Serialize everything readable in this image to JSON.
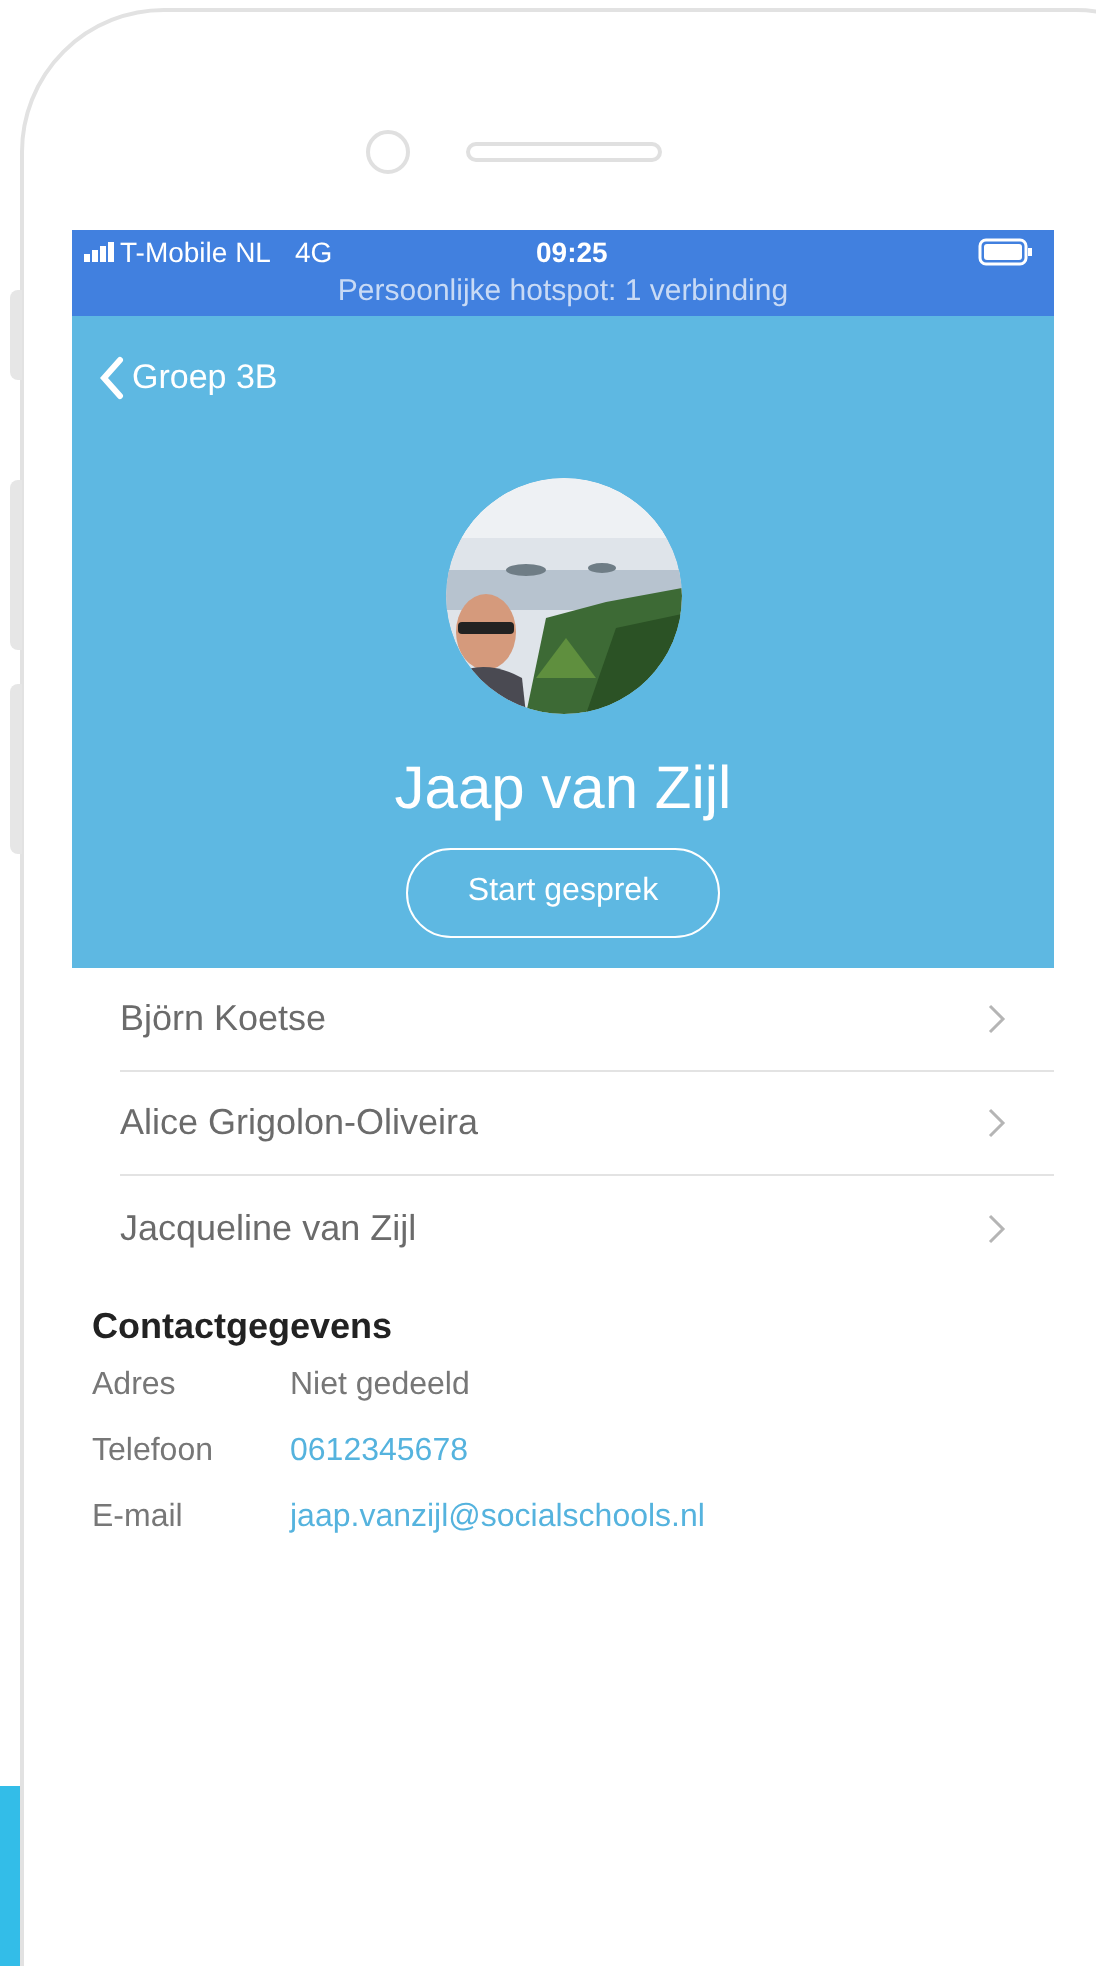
{
  "status_bar": {
    "carrier": "T-Mobile NL",
    "network": "4G",
    "time": "09:25",
    "hotspot": "Persoonlijke hotspot: 1 verbinding"
  },
  "nav": {
    "back_label": "Groep 3B"
  },
  "profile": {
    "name": "Jaap van Zijl",
    "button": "Start gesprek"
  },
  "related": [
    {
      "name": "Björn Koetse"
    },
    {
      "name": "Alice Grigolon-Oliveira"
    },
    {
      "name": "Jacqueline van Zijl"
    }
  ],
  "contact": {
    "heading": "Contactgegevens",
    "rows": [
      {
        "label": "Adres",
        "value": "Niet gedeeld",
        "kind": "text"
      },
      {
        "label": "Telefoon",
        "value": "0612345678",
        "kind": "link"
      },
      {
        "label": "E-mail",
        "value": "jaap.vanzijl@socialschools.nl",
        "kind": "link"
      }
    ]
  }
}
